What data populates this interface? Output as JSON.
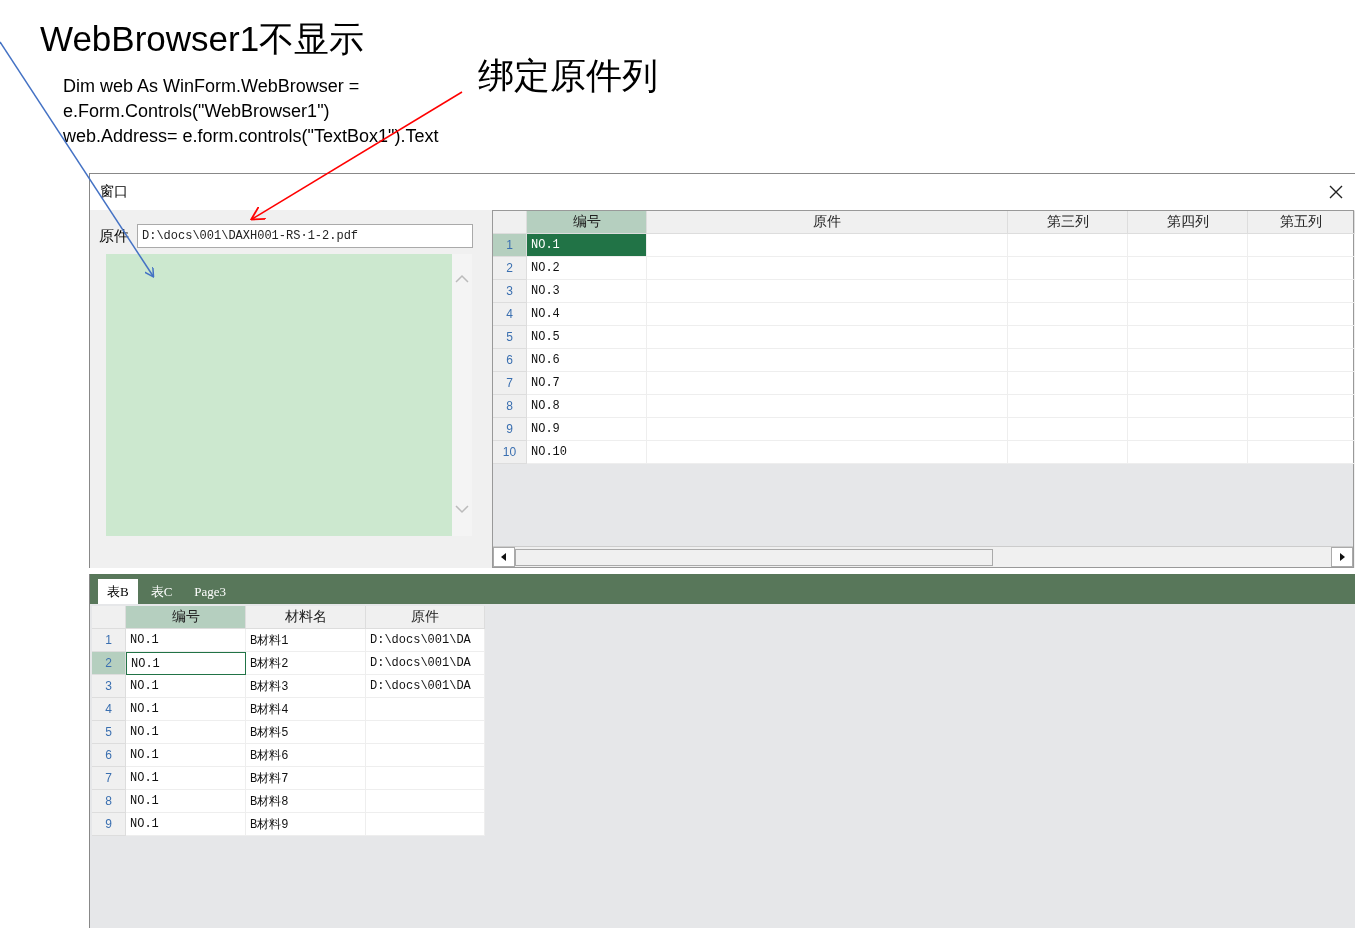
{
  "annotations": {
    "title": "WebBrowser1不显示",
    "code_lines": [
      "Dim web As WinForm.WebBrowser =",
      "e.Form.Controls(\"WebBrowser1\")",
      "web.Address= e.form.controls(\"TextBox1\").Text"
    ],
    "bind_note": "绑定原件列"
  },
  "window": {
    "title": "窗口"
  },
  "file_field": {
    "label": "原件",
    "value": "D:\\docs\\001\\DAXH001-RS·1-2.pdf"
  },
  "main_grid": {
    "columns": [
      {
        "label": "编号",
        "selected": true
      },
      {
        "label": "原件",
        "selected": false
      },
      {
        "label": "第三列",
        "selected": false
      },
      {
        "label": "第四列",
        "selected": false
      },
      {
        "label": "第五列",
        "selected": false
      }
    ],
    "rows": [
      {
        "number": "1",
        "cells": [
          "NO.1"
        ],
        "selected": true
      },
      {
        "number": "2",
        "cells": [
          "NO.2"
        ],
        "selected": false
      },
      {
        "number": "3",
        "cells": [
          "NO.3"
        ],
        "selected": false
      },
      {
        "number": "4",
        "cells": [
          "NO.4"
        ],
        "selected": false
      },
      {
        "number": "5",
        "cells": [
          "NO.5"
        ],
        "selected": false
      },
      {
        "number": "6",
        "cells": [
          "NO.6"
        ],
        "selected": false
      },
      {
        "number": "7",
        "cells": [
          "NO.7"
        ],
        "selected": false
      },
      {
        "number": "8",
        "cells": [
          "NO.8"
        ],
        "selected": false
      },
      {
        "number": "9",
        "cells": [
          "NO.9"
        ],
        "selected": false
      },
      {
        "number": "10",
        "cells": [
          "NO.10"
        ],
        "selected": false
      }
    ]
  },
  "tabs": [
    {
      "label": "表B",
      "selected": true
    },
    {
      "label": "表C",
      "selected": false
    },
    {
      "label": "Page3",
      "selected": false
    }
  ],
  "sub_grid": {
    "columns": [
      {
        "label": "编号",
        "selected": true
      },
      {
        "label": "材料名",
        "selected": false
      },
      {
        "label": "原件",
        "selected": false
      }
    ],
    "rows": [
      {
        "number": "1",
        "cells": [
          "NO.1",
          "B材料1",
          "D:\\docs\\001\\DA"
        ],
        "selected": false
      },
      {
        "number": "2",
        "cells": [
          "NO.1",
          "B材料2",
          "D:\\docs\\001\\DA"
        ],
        "selected": true
      },
      {
        "number": "3",
        "cells": [
          "NO.1",
          "B材料3",
          "D:\\docs\\001\\DA"
        ],
        "selected": false
      },
      {
        "number": "4",
        "cells": [
          "NO.1",
          "B材料4"
        ],
        "selected": false
      },
      {
        "number": "5",
        "cells": [
          "NO.1",
          "B材料5"
        ],
        "selected": false
      },
      {
        "number": "6",
        "cells": [
          "NO.1",
          "B材料6"
        ],
        "selected": false
      },
      {
        "number": "7",
        "cells": [
          "NO.1",
          "B材料7"
        ],
        "selected": false
      },
      {
        "number": "8",
        "cells": [
          "NO.1",
          "B材料8"
        ],
        "selected": false
      },
      {
        "number": "9",
        "cells": [
          "NO.1",
          "B材料9"
        ],
        "selected": false
      }
    ]
  }
}
